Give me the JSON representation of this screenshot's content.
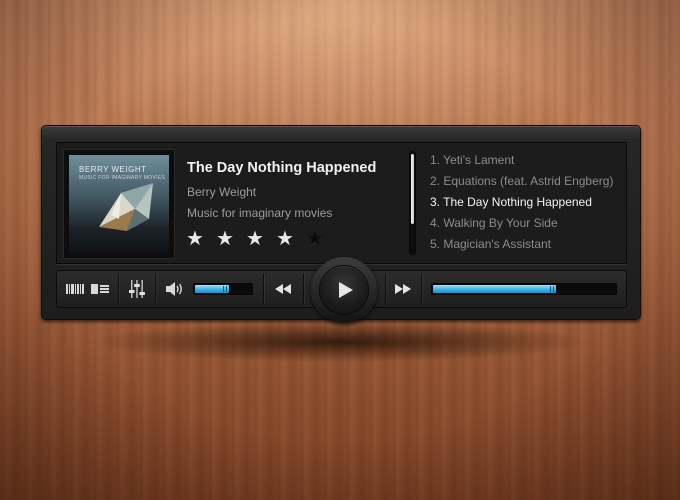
{
  "now_playing": {
    "title": "The Day Nothing Happened",
    "artist": "Berry Weight",
    "album": "Music for imaginary movies",
    "album_art_text": {
      "band": "Berry Weight",
      "subtitle": "Music for imaginary movies"
    },
    "rating": 4,
    "rating_max": 5
  },
  "playlist": {
    "items": [
      "1. Yeti's Lament",
      "2. Equations (feat. Astrid Engberg)",
      "3. The Day Nothing Happened",
      "4. Walking By Your Side",
      "5. Magician's Assistant"
    ],
    "current_index": 2
  },
  "controls": {
    "icons": [
      "barcode-view-icon",
      "list-view-icon",
      "equalizer-icon",
      "volume-icon",
      "rewind-icon",
      "play-icon",
      "fast-forward-icon"
    ],
    "volume_level": 0.62,
    "progress": 0.68
  },
  "colors": {
    "accent": "#3fb6ec",
    "panel": "#1c1c1c",
    "text_active": "#f4f4f4",
    "text_muted": "#8c8c8c"
  }
}
